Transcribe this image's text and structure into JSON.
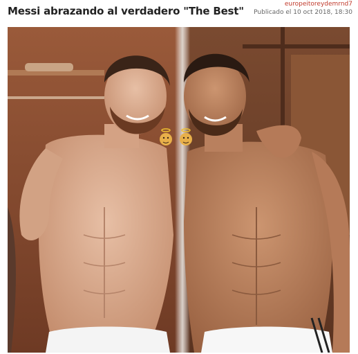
{
  "post": {
    "title": "Messi abrazando al verdadero \"The Best\"",
    "author": "europeitoreydemrnd7",
    "date_label": "Publicado el 10 oct 2018, 18:30"
  },
  "image": {
    "icons": [
      "angel-emoji-icon",
      "angel-emoji-icon"
    ],
    "colors": {
      "wall": "#8a4a2e",
      "skin": "#c98d6c",
      "hair": "#3a2418",
      "shorts": "#ffffff"
    }
  }
}
